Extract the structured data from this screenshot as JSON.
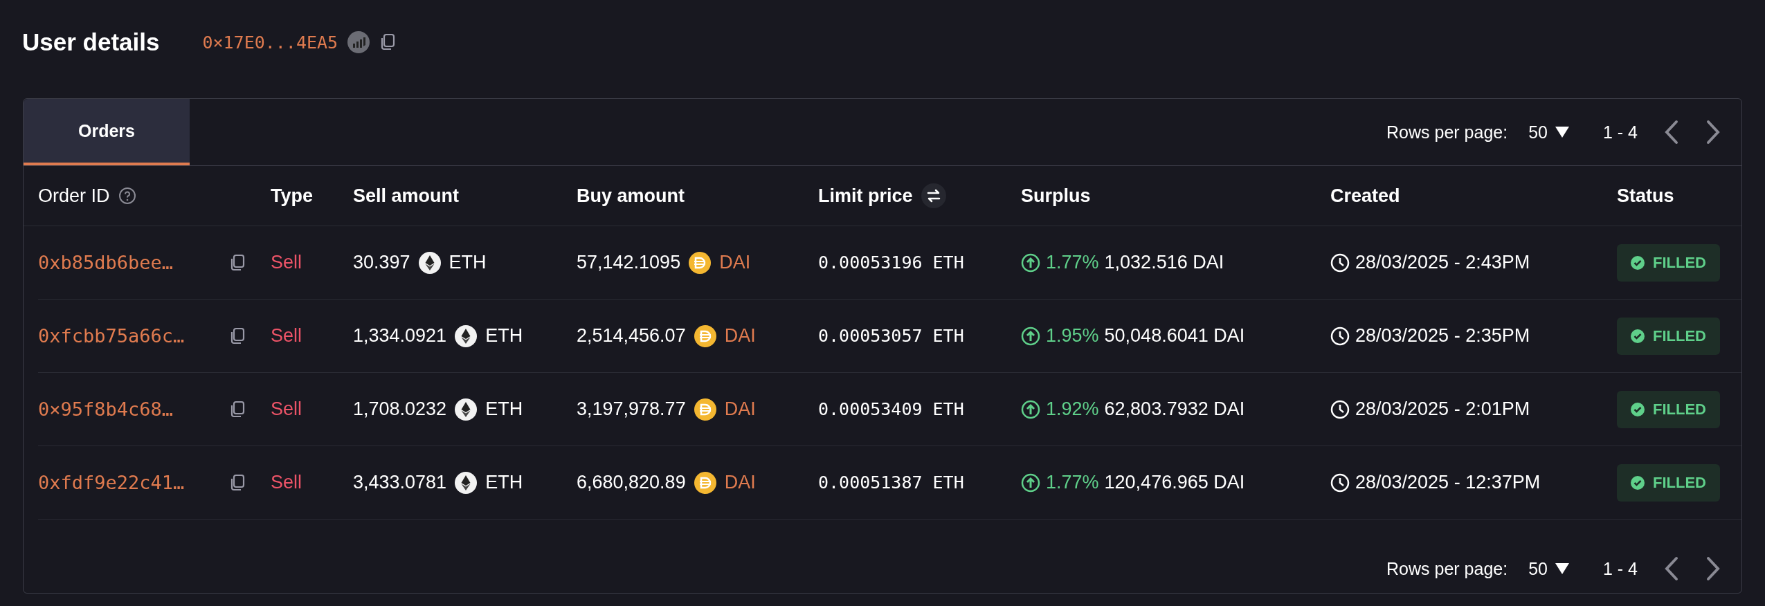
{
  "header": {
    "title": "User details",
    "address": "0×17E0...4EA5"
  },
  "tabs": [
    {
      "label": "Orders",
      "selected": true
    }
  ],
  "pagination_top": {
    "label": "Rows per page:",
    "value": "50",
    "range": "1 - 4"
  },
  "table": {
    "columns": [
      {
        "label": "Order ID"
      },
      {
        "label": "Type"
      },
      {
        "label": "Sell amount"
      },
      {
        "label": "Buy amount"
      },
      {
        "label": "Limit price"
      },
      {
        "label": "Surplus"
      },
      {
        "label": "Created"
      },
      {
        "label": "Status"
      }
    ],
    "rows": [
      {
        "order_id": "0xb85db6bee…",
        "type": "Sell",
        "sell_amount": "30.397",
        "sell_token": "ETH",
        "buy_amount": "57,142.1095",
        "buy_token": "DAI",
        "limit_price": "0.00053196 ETH",
        "surplus_percent": "1.77%",
        "surplus_amount": "1,032.516 DAI",
        "created": "28/03/2025 - 2:43PM",
        "status": "FILLED"
      },
      {
        "order_id": "0xfcbb75a66c…",
        "type": "Sell",
        "sell_amount": "1,334.0921",
        "sell_token": "ETH",
        "buy_amount": "2,514,456.07",
        "buy_token": "DAI",
        "limit_price": "0.00053057 ETH",
        "surplus_percent": "1.95%",
        "surplus_amount": "50,048.6041 DAI",
        "created": "28/03/2025 - 2:35PM",
        "status": "FILLED"
      },
      {
        "order_id": "0×95f8b4c68…",
        "type": "Sell",
        "sell_amount": "1,708.0232",
        "sell_token": "ETH",
        "buy_amount": "3,197,978.77",
        "buy_token": "DAI",
        "limit_price": "0.00053409 ETH",
        "surplus_percent": "1.92%",
        "surplus_amount": "62,803.7932 DAI",
        "created": "28/03/2025 - 2:01PM",
        "status": "FILLED"
      },
      {
        "order_id": "0xfdf9e22c41…",
        "type": "Sell",
        "sell_amount": "3,433.0781",
        "sell_token": "ETH",
        "buy_amount": "6,680,820.89",
        "buy_token": "DAI",
        "limit_price": "0.00051387 ETH",
        "surplus_percent": "1.77%",
        "surplus_amount": "120,476.965 DAI",
        "created": "28/03/2025 - 12:37PM",
        "status": "FILLED"
      }
    ]
  },
  "pagination_bottom": {
    "label": "Rows per page:",
    "value": "50",
    "range": "1 - 4"
  }
}
